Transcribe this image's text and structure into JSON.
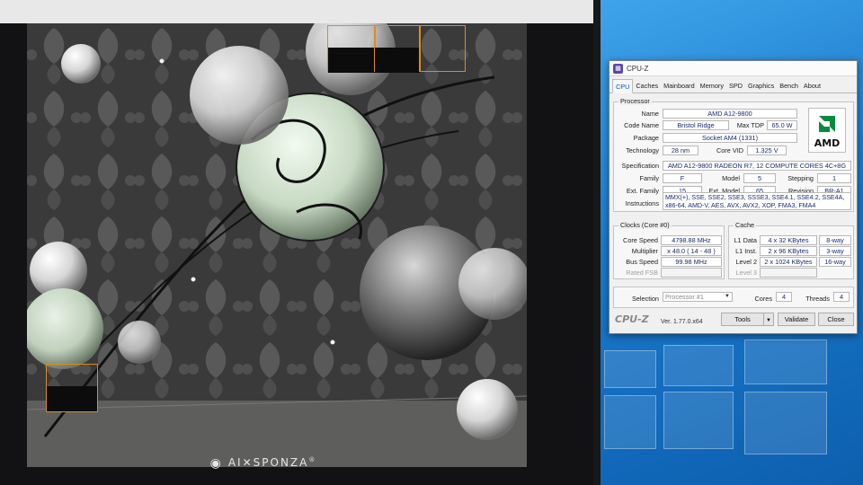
{
  "window": {
    "title": "CPU-Z"
  },
  "tabs": [
    {
      "label": "CPU",
      "active": true
    },
    {
      "label": "Caches"
    },
    {
      "label": "Mainboard"
    },
    {
      "label": "Memory"
    },
    {
      "label": "SPD"
    },
    {
      "label": "Graphics"
    },
    {
      "label": "Bench"
    },
    {
      "label": "About"
    }
  ],
  "processor": {
    "group_title": "Processor",
    "name_label": "Name",
    "name": "AMD A12-9800",
    "codename_label": "Code Name",
    "codename": "Bristol Ridge",
    "maxtdp_label": "Max TDP",
    "maxtdp": "65.0 W",
    "package_label": "Package",
    "package": "Socket AM4 (1331)",
    "technology_label": "Technology",
    "technology": "28 nm",
    "corevid_label": "Core VID",
    "corevid": "1.325 V",
    "spec_label": "Specification",
    "spec": "AMD A12-9800 RADEON R7, 12 COMPUTE CORES 4C+8G",
    "family_label": "Family",
    "family": "F",
    "model_label": "Model",
    "model": "5",
    "stepping_label": "Stepping",
    "stepping": "1",
    "extfamily_label": "Ext. Family",
    "extfamily": "15",
    "extmodel_label": "Ext. Model",
    "extmodel": "65",
    "revision_label": "Revision",
    "revision": "BR-A1",
    "instr_label": "Instructions",
    "instructions": "MMX(+), SSE, SSE2, SSE3, SSSE3, SSE4.1, SSE4.2, SSE4A, x86-64, AMD-V, AES, AVX, AVX2, XOP, FMA3, FMA4",
    "logo_text": "AMD"
  },
  "clocks": {
    "group_title": "Clocks (Core #0)",
    "corespeed_label": "Core Speed",
    "corespeed": "4798.88 MHz",
    "multiplier_label": "Multiplier",
    "multiplier": "x 48.0 ( 14 - 48 )",
    "busspeed_label": "Bus Speed",
    "busspeed": "99.98 MHz",
    "ratedfsb_label": "Rated FSB",
    "ratedfsb": ""
  },
  "cache": {
    "group_title": "Cache",
    "l1data_label": "L1 Data",
    "l1data": "4 x 32 KBytes",
    "l1data_way": "8-way",
    "l1inst_label": "L1 Inst.",
    "l1inst": "2 x 96 KBytes",
    "l1inst_way": "3-way",
    "level2_label": "Level 2",
    "level2": "2 x 1024 KBytes",
    "level2_way": "16-way",
    "level3_label": "Level 3",
    "level3": ""
  },
  "selection": {
    "label": "Selection",
    "value": "Processor #1",
    "cores_label": "Cores",
    "cores": "4",
    "threads_label": "Threads",
    "threads": "4"
  },
  "footer": {
    "brand": "CPU-Z",
    "version": "Ver. 1.77.0.x64",
    "tools": "Tools",
    "validate": "Validate",
    "close": "Close"
  },
  "render": {
    "watermark": "AI✕SPONZA",
    "registered": "®"
  },
  "colors": {
    "bucket_outline": "#e08a1e",
    "value_text": "#1a2a6c",
    "desktop_blue": "#1a79cc"
  }
}
